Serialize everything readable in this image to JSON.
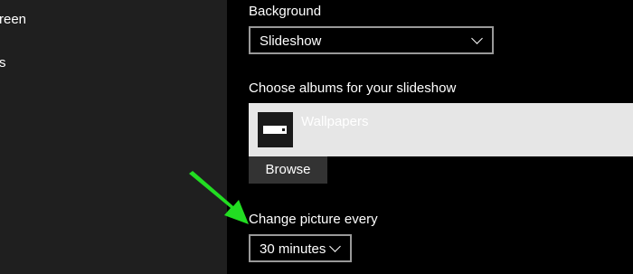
{
  "sidebar": {
    "items": [
      {
        "label": "reen"
      },
      {
        "label": "s"
      }
    ]
  },
  "background": {
    "label": "Background",
    "selected": "Slideshow"
  },
  "albums": {
    "label": "Choose albums for your slideshow",
    "items": [
      {
        "name": "Wallpapers",
        "icon": "folder-icon"
      }
    ],
    "browse_label": "Browse"
  },
  "interval": {
    "label": "Change picture every",
    "selected": "30 minutes"
  },
  "colors": {
    "background": "#000000",
    "sidebar": "#1f1f1f",
    "album_panel": "#e6e6e6",
    "button": "#333333",
    "annotation_arrow": "#22dd22"
  }
}
